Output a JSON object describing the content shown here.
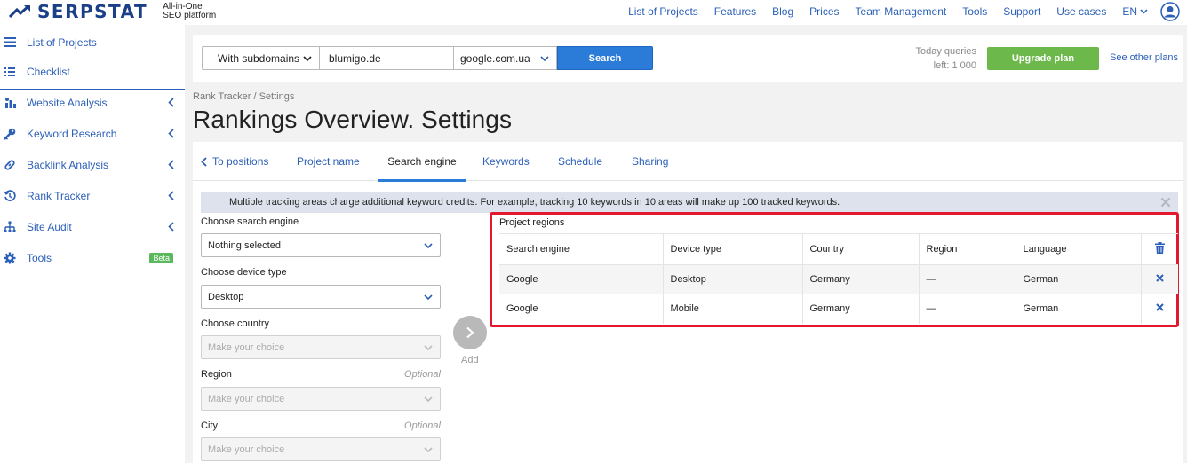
{
  "brand": {
    "name": "SERPSTAT",
    "tagline_line1": "All-in-One",
    "tagline_line2": "SEO platform"
  },
  "topnav": {
    "items": [
      "List of Projects",
      "Features",
      "Blog",
      "Prices",
      "Team Management",
      "Tools",
      "Support",
      "Use cases"
    ],
    "language": "EN"
  },
  "sidebar": {
    "items": [
      {
        "label": "List of Projects",
        "icon": "list-icon"
      },
      {
        "label": "Checklist",
        "icon": "checklist-icon"
      },
      {
        "label": "Website Analysis",
        "icon": "website-analysis-icon"
      },
      {
        "label": "Keyword Research",
        "icon": "key-icon"
      },
      {
        "label": "Backlink Analysis",
        "icon": "link-icon"
      },
      {
        "label": "Rank Tracker",
        "icon": "rank-tracker-icon"
      },
      {
        "label": "Site Audit",
        "icon": "site-audit-icon"
      },
      {
        "label": "Tools",
        "icon": "gear-icon",
        "badge": "Beta"
      }
    ]
  },
  "search": {
    "scope": "With subdomains",
    "domain": "blumigo.de",
    "database": "google.com.ua",
    "button": "Search",
    "quota_line1": "Today queries",
    "quota_line2": "left: 1 000",
    "upgrade": "Upgrade plan",
    "other_plans": "See other plans"
  },
  "breadcrumb": "Rank Tracker / Settings",
  "page_title": "Rankings Overview. Settings",
  "tabs": {
    "back": "To positions",
    "items": [
      "Project name",
      "Search engine",
      "Keywords",
      "Schedule",
      "Sharing"
    ],
    "active": "Search engine"
  },
  "notice": "Multiple tracking areas charge additional keyword credits. For example, tracking 10 keywords in 10 areas will make up 100 tracked keywords.",
  "form": {
    "engine_label": "Choose search engine",
    "engine_value": "Nothing selected",
    "device_label": "Choose device type",
    "device_value": "Desktop",
    "country_label": "Choose country",
    "country_placeholder": "Make your choice",
    "region_label": "Region",
    "region_optional": "Optional",
    "region_placeholder": "Make your choice",
    "city_label": "City",
    "city_optional": "Optional",
    "city_placeholder": "Make your choice",
    "add_label": "Add"
  },
  "regions": {
    "title": "Project regions",
    "columns": [
      "Search engine",
      "Device type",
      "Country",
      "Region",
      "Language"
    ],
    "rows": [
      [
        "Google",
        "Desktop",
        "Germany",
        "—",
        "German"
      ],
      [
        "Google",
        "Mobile",
        "Germany",
        "—",
        "German"
      ]
    ]
  },
  "colors": {
    "accent": "#2b7bd8",
    "link": "#2b5fb8",
    "upgrade": "#6db84a",
    "highlight": "#e3182e"
  }
}
